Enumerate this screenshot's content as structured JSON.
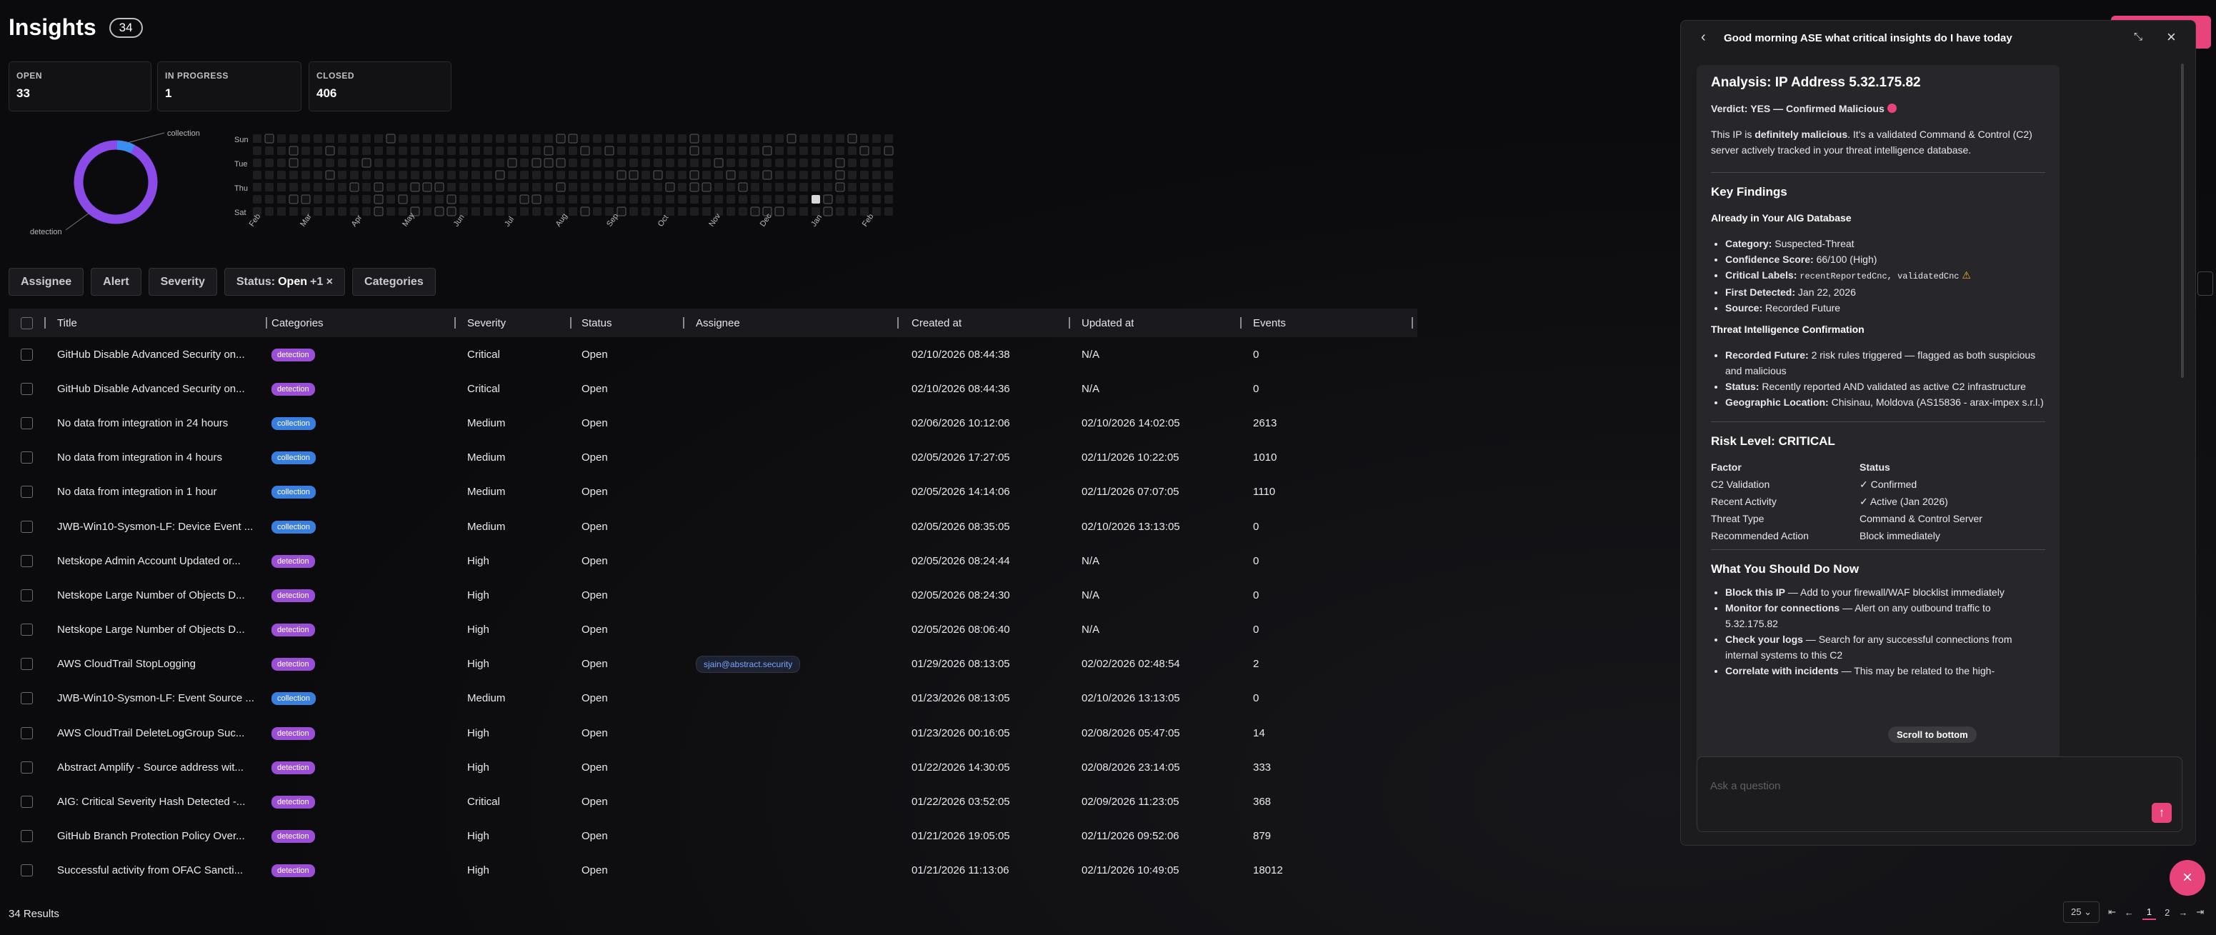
{
  "header": {
    "title": "Insights",
    "count": "34"
  },
  "stats": [
    {
      "label": "OPEN",
      "value": "33"
    },
    {
      "label": "IN PROGRESS",
      "value": "1"
    },
    {
      "label": "CLOSED",
      "value": "406"
    }
  ],
  "donut": {
    "label_collection": "collection",
    "label_detection": "detection",
    "collection_fraction": 0.07
  },
  "heatmap": {
    "days": [
      "Sun",
      "Tue",
      "Thu",
      "Sat"
    ],
    "months": [
      "Feb",
      "Mar",
      "Apr",
      "May",
      "Jun",
      "Jul",
      "Aug",
      "Sep",
      "Oct",
      "Nov",
      "Dec",
      "Jan",
      "Feb"
    ]
  },
  "filters": {
    "assignee": "Assignee",
    "alert": "Alert",
    "severity": "Severity",
    "status_prefix": "Status:",
    "status_value": "Open",
    "status_extra": "+1 ×",
    "categories": "Categories"
  },
  "columns": [
    "Title",
    "Categories",
    "Severity",
    "Status",
    "Assignee",
    "Created at",
    "Updated at",
    "Events"
  ],
  "rows": [
    {
      "title": "GitHub Disable Advanced Security on...",
      "cat": "detection",
      "sev": "Critical",
      "status": "Open",
      "assignee": "",
      "created": "02/10/2026 08:44:38",
      "updated": "N/A",
      "events": "0"
    },
    {
      "title": "GitHub Disable Advanced Security on...",
      "cat": "detection",
      "sev": "Critical",
      "status": "Open",
      "assignee": "",
      "created": "02/10/2026 08:44:36",
      "updated": "N/A",
      "events": "0"
    },
    {
      "title": "No data from integration in 24 hours",
      "cat": "collection",
      "sev": "Medium",
      "status": "Open",
      "assignee": "",
      "created": "02/06/2026 10:12:06",
      "updated": "02/10/2026 14:02:05",
      "events": "2613"
    },
    {
      "title": "No data from integration in 4 hours",
      "cat": "collection",
      "sev": "Medium",
      "status": "Open",
      "assignee": "",
      "created": "02/05/2026 17:27:05",
      "updated": "02/11/2026 10:22:05",
      "events": "1010"
    },
    {
      "title": "No data from integration in 1 hour",
      "cat": "collection",
      "sev": "Medium",
      "status": "Open",
      "assignee": "",
      "created": "02/05/2026 14:14:06",
      "updated": "02/11/2026 07:07:05",
      "events": "1110"
    },
    {
      "title": "JWB-Win10-Sysmon-LF: Device Event ...",
      "cat": "collection",
      "sev": "Medium",
      "status": "Open",
      "assignee": "",
      "created": "02/05/2026 08:35:05",
      "updated": "02/10/2026 13:13:05",
      "events": "0"
    },
    {
      "title": "Netskope Admin Account Updated or...",
      "cat": "detection",
      "sev": "High",
      "status": "Open",
      "assignee": "",
      "created": "02/05/2026 08:24:44",
      "updated": "N/A",
      "events": "0"
    },
    {
      "title": "Netskope Large Number of Objects D...",
      "cat": "detection",
      "sev": "High",
      "status": "Open",
      "assignee": "",
      "created": "02/05/2026 08:24:30",
      "updated": "N/A",
      "events": "0"
    },
    {
      "title": "Netskope Large Number of Objects D...",
      "cat": "detection",
      "sev": "High",
      "status": "Open",
      "assignee": "",
      "created": "02/05/2026 08:06:40",
      "updated": "N/A",
      "events": "0"
    },
    {
      "title": "AWS CloudTrail StopLogging",
      "cat": "detection",
      "sev": "High",
      "status": "Open",
      "assignee": "sjain@abstract.security",
      "created": "01/29/2026 08:13:05",
      "updated": "02/02/2026 02:48:54",
      "events": "2"
    },
    {
      "title": "JWB-Win10-Sysmon-LF: Event Source ...",
      "cat": "collection",
      "sev": "Medium",
      "status": "Open",
      "assignee": "",
      "created": "01/23/2026 08:13:05",
      "updated": "02/10/2026 13:13:05",
      "events": "0"
    },
    {
      "title": "AWS CloudTrail DeleteLogGroup Suc...",
      "cat": "detection",
      "sev": "High",
      "status": "Open",
      "assignee": "",
      "created": "01/23/2026 00:16:05",
      "updated": "02/08/2026 05:47:05",
      "events": "14"
    },
    {
      "title": "Abstract Amplify - Source address wit...",
      "cat": "detection",
      "sev": "High",
      "status": "Open",
      "assignee": "",
      "created": "01/22/2026 14:30:05",
      "updated": "02/08/2026 23:14:05",
      "events": "333"
    },
    {
      "title": "AIG: Critical Severity Hash Detected -...",
      "cat": "detection",
      "sev": "Critical",
      "status": "Open",
      "assignee": "",
      "created": "01/22/2026 03:52:05",
      "updated": "02/09/2026 11:23:05",
      "events": "368"
    },
    {
      "title": "GitHub Branch Protection Policy Over...",
      "cat": "detection",
      "sev": "High",
      "status": "Open",
      "assignee": "",
      "created": "01/21/2026 19:05:05",
      "updated": "02/11/2026 09:52:06",
      "events": "879"
    },
    {
      "title": "Successful activity from OFAC Sancti...",
      "cat": "detection",
      "sev": "High",
      "status": "Open",
      "assignee": "",
      "created": "01/21/2026 11:13:06",
      "updated": "02/11/2026 10:49:05",
      "events": "18012"
    }
  ],
  "footer": {
    "results": "34 Results",
    "page_size": "25",
    "page_current": "1",
    "page_next": "2"
  },
  "panel": {
    "title": "Good morning ASE what critical insights do I have today",
    "analysis_title": "Analysis: IP Address 5.32.175.82",
    "verdict_label": "Verdict:",
    "verdict_text": "YES — Confirmed Malicious",
    "intro_a": "This IP is ",
    "intro_b": "definitely malicious",
    "intro_c": ". It's a validated Command & Control (C2) server actively tracked in your threat intelligence database.",
    "key_findings": "Key Findings",
    "already": "Already in Your AIG Database",
    "findings": [
      {
        "k": "Category:",
        "v": " Suspected-Threat"
      },
      {
        "k": "Confidence Score:",
        "v": " 66/100 (High)"
      },
      {
        "k": "First Detected:",
        "v": " Jan 22, 2026"
      },
      {
        "k": "Source:",
        "v": " Recorded Future"
      }
    ],
    "critical_labels_k": "Critical Labels:",
    "critical_labels_v": "recentReportedCnc, validatedCnc",
    "warn": "⚠",
    "tic": "Threat Intelligence Confirmation",
    "tic_items": [
      {
        "k": "Recorded Future:",
        "v": " 2 risk rules triggered — flagged as both suspicious and malicious"
      },
      {
        "k": "Status:",
        "v": " Recently reported AND validated as active C2 infrastructure"
      },
      {
        "k": "Geographic Location:",
        "v": " Chisinau, Moldova (AS15836 - arax-impex s.r.l.)"
      }
    ],
    "risk_level": "Risk Level: CRITICAL",
    "risk_head": [
      "Factor",
      "Status"
    ],
    "risk_rows": [
      [
        "C2 Validation",
        "✓ Confirmed"
      ],
      [
        "Recent Activity",
        "✓ Active (Jan 2026)"
      ],
      [
        "Threat Type",
        "Command & Control Server"
      ],
      [
        "Recommended Action",
        "Block immediately"
      ]
    ],
    "todo": "What You Should Do Now",
    "todo_items": [
      {
        "k": "Block this IP",
        "v": " — Add to your firewall/WAF blocklist immediately"
      },
      {
        "k": "Monitor for connections",
        "v": " — Alert on any outbound traffic to 5.32.175.82"
      },
      {
        "k": "Check your logs",
        "v": " — Search for any successful connections from internal systems to this C2"
      },
      {
        "k": "Correlate with incidents",
        "v": " — This may be related to the high-"
      }
    ],
    "scroll_bottom": "Scroll to bottom",
    "ask_placeholder": "Ask a question",
    "colors": {
      "accent": "#e8437a",
      "verdict_dot": "#e8437a"
    }
  }
}
